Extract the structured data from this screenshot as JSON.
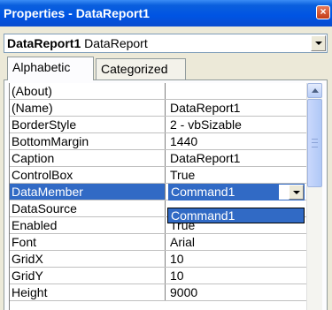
{
  "window": {
    "title": "Properties - DataReport1",
    "close_glyph": "×"
  },
  "object_selector": {
    "object_name": "DataReport1",
    "object_type": "DataReport"
  },
  "tabs": [
    {
      "label": "Alphabetic",
      "active": true
    },
    {
      "label": "Categorized",
      "active": false
    }
  ],
  "properties": [
    {
      "name": "(About)",
      "value": ""
    },
    {
      "name": "(Name)",
      "value": "DataReport1"
    },
    {
      "name": "BorderStyle",
      "value": "2 - vbSizable"
    },
    {
      "name": "BottomMargin",
      "value": "1440"
    },
    {
      "name": "Caption",
      "value": "DataReport1"
    },
    {
      "name": "ControlBox",
      "value": "True"
    },
    {
      "name": "DataMember",
      "value": "Command1"
    },
    {
      "name": "DataSource",
      "value": ""
    },
    {
      "name": "Enabled",
      "value": "True"
    },
    {
      "name": "Font",
      "value": "Arial"
    },
    {
      "name": "GridX",
      "value": "10"
    },
    {
      "name": "GridY",
      "value": "10"
    },
    {
      "name": "Height",
      "value": "9000"
    }
  ],
  "dropdown": {
    "options": [
      "Command1"
    ]
  },
  "colors": {
    "titlebar": "#0054e3",
    "selection": "#316ac5"
  }
}
